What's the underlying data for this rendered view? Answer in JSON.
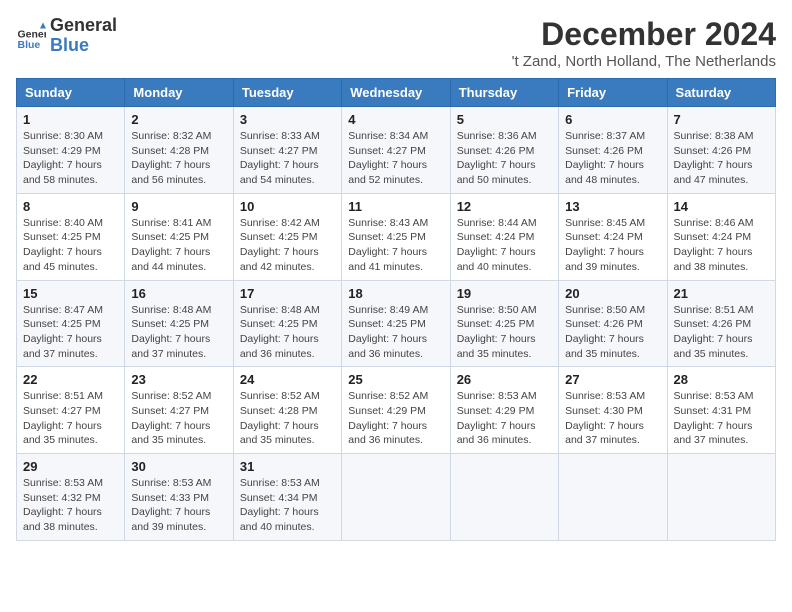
{
  "logo": {
    "line1": "General",
    "line2": "Blue"
  },
  "title": "December 2024",
  "location": "'t Zand, North Holland, The Netherlands",
  "weekdays": [
    "Sunday",
    "Monday",
    "Tuesday",
    "Wednesday",
    "Thursday",
    "Friday",
    "Saturday"
  ],
  "weeks": [
    [
      {
        "day": "1",
        "sunrise": "8:30 AM",
        "sunset": "4:29 PM",
        "daylight": "7 hours and 58 minutes."
      },
      {
        "day": "2",
        "sunrise": "8:32 AM",
        "sunset": "4:28 PM",
        "daylight": "7 hours and 56 minutes."
      },
      {
        "day": "3",
        "sunrise": "8:33 AM",
        "sunset": "4:27 PM",
        "daylight": "7 hours and 54 minutes."
      },
      {
        "day": "4",
        "sunrise": "8:34 AM",
        "sunset": "4:27 PM",
        "daylight": "7 hours and 52 minutes."
      },
      {
        "day": "5",
        "sunrise": "8:36 AM",
        "sunset": "4:26 PM",
        "daylight": "7 hours and 50 minutes."
      },
      {
        "day": "6",
        "sunrise": "8:37 AM",
        "sunset": "4:26 PM",
        "daylight": "7 hours and 48 minutes."
      },
      {
        "day": "7",
        "sunrise": "8:38 AM",
        "sunset": "4:26 PM",
        "daylight": "7 hours and 47 minutes."
      }
    ],
    [
      {
        "day": "8",
        "sunrise": "8:40 AM",
        "sunset": "4:25 PM",
        "daylight": "7 hours and 45 minutes."
      },
      {
        "day": "9",
        "sunrise": "8:41 AM",
        "sunset": "4:25 PM",
        "daylight": "7 hours and 44 minutes."
      },
      {
        "day": "10",
        "sunrise": "8:42 AM",
        "sunset": "4:25 PM",
        "daylight": "7 hours and 42 minutes."
      },
      {
        "day": "11",
        "sunrise": "8:43 AM",
        "sunset": "4:25 PM",
        "daylight": "7 hours and 41 minutes."
      },
      {
        "day": "12",
        "sunrise": "8:44 AM",
        "sunset": "4:24 PM",
        "daylight": "7 hours and 40 minutes."
      },
      {
        "day": "13",
        "sunrise": "8:45 AM",
        "sunset": "4:24 PM",
        "daylight": "7 hours and 39 minutes."
      },
      {
        "day": "14",
        "sunrise": "8:46 AM",
        "sunset": "4:24 PM",
        "daylight": "7 hours and 38 minutes."
      }
    ],
    [
      {
        "day": "15",
        "sunrise": "8:47 AM",
        "sunset": "4:25 PM",
        "daylight": "7 hours and 37 minutes."
      },
      {
        "day": "16",
        "sunrise": "8:48 AM",
        "sunset": "4:25 PM",
        "daylight": "7 hours and 37 minutes."
      },
      {
        "day": "17",
        "sunrise": "8:48 AM",
        "sunset": "4:25 PM",
        "daylight": "7 hours and 36 minutes."
      },
      {
        "day": "18",
        "sunrise": "8:49 AM",
        "sunset": "4:25 PM",
        "daylight": "7 hours and 36 minutes."
      },
      {
        "day": "19",
        "sunrise": "8:50 AM",
        "sunset": "4:25 PM",
        "daylight": "7 hours and 35 minutes."
      },
      {
        "day": "20",
        "sunrise": "8:50 AM",
        "sunset": "4:26 PM",
        "daylight": "7 hours and 35 minutes."
      },
      {
        "day": "21",
        "sunrise": "8:51 AM",
        "sunset": "4:26 PM",
        "daylight": "7 hours and 35 minutes."
      }
    ],
    [
      {
        "day": "22",
        "sunrise": "8:51 AM",
        "sunset": "4:27 PM",
        "daylight": "7 hours and 35 minutes."
      },
      {
        "day": "23",
        "sunrise": "8:52 AM",
        "sunset": "4:27 PM",
        "daylight": "7 hours and 35 minutes."
      },
      {
        "day": "24",
        "sunrise": "8:52 AM",
        "sunset": "4:28 PM",
        "daylight": "7 hours and 35 minutes."
      },
      {
        "day": "25",
        "sunrise": "8:52 AM",
        "sunset": "4:29 PM",
        "daylight": "7 hours and 36 minutes."
      },
      {
        "day": "26",
        "sunrise": "8:53 AM",
        "sunset": "4:29 PM",
        "daylight": "7 hours and 36 minutes."
      },
      {
        "day": "27",
        "sunrise": "8:53 AM",
        "sunset": "4:30 PM",
        "daylight": "7 hours and 37 minutes."
      },
      {
        "day": "28",
        "sunrise": "8:53 AM",
        "sunset": "4:31 PM",
        "daylight": "7 hours and 37 minutes."
      }
    ],
    [
      {
        "day": "29",
        "sunrise": "8:53 AM",
        "sunset": "4:32 PM",
        "daylight": "7 hours and 38 minutes."
      },
      {
        "day": "30",
        "sunrise": "8:53 AM",
        "sunset": "4:33 PM",
        "daylight": "7 hours and 39 minutes."
      },
      {
        "day": "31",
        "sunrise": "8:53 AM",
        "sunset": "4:34 PM",
        "daylight": "7 hours and 40 minutes."
      },
      null,
      null,
      null,
      null
    ]
  ],
  "labels": {
    "sunrise": "Sunrise: ",
    "sunset": "Sunset: ",
    "daylight": "Daylight: "
  }
}
